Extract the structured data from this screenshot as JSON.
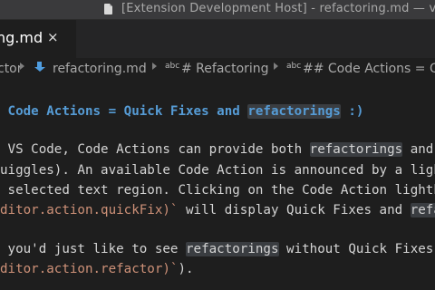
{
  "window": {
    "title": "[Extension Development Host] - refactoring.md — vscode"
  },
  "tab": {
    "label": "ng.md",
    "close_glyph": "×"
  },
  "breadcrumb": {
    "root": "ctor",
    "file": "refactoring.md",
    "section1": "# Refactoring",
    "section2": "## Code Actions = Q",
    "symbol_tag": "abc",
    "file_icon": "markdown-file-icon"
  },
  "editor": {
    "heading": {
      "pre": " Code Actions = Quick Fixes and ",
      "hl": "refactorings",
      "post": " :)"
    },
    "line1": {
      "pre": " VS Code, Code Actions can provide both ",
      "hl": "refactorings",
      "post": " and"
    },
    "line2": {
      "text": "uiggles). An available Code Action is announced by a ligh"
    },
    "line3": {
      "text": " selected text region. Clicking on the Code Action lightb"
    },
    "line4": {
      "code": "ditor.action.quickFix)`",
      "mid": " will display Quick Fixes and ",
      "hl": "refa"
    },
    "line5": {
      "pre": " you'd just like to see ",
      "hl": "refactorings",
      "post": " without Quick Fixes"
    },
    "line6": {
      "code": "ditor.action.refactor)`",
      "post": ")."
    }
  }
}
